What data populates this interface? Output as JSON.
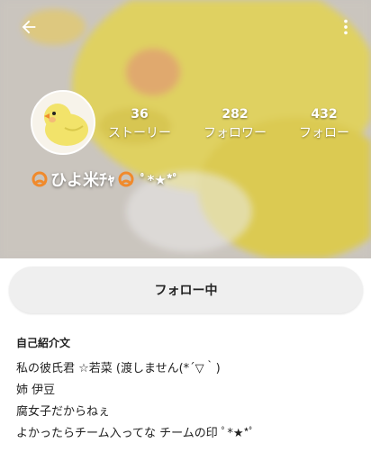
{
  "header": {
    "back_icon": "arrow-left-icon",
    "more_icon": "more-vertical-icon"
  },
  "profile": {
    "avatar_icon": "chick-avatar",
    "name": "ひよ米ﾁｬ",
    "name_suffix": "ﾟ*★*ﾟ",
    "name_decoration_icon": "orange-ornament-icon",
    "stats": [
      {
        "value": "36",
        "label": "ストーリー"
      },
      {
        "value": "282",
        "label": "フォロワー"
      },
      {
        "value": "432",
        "label": "フォロー"
      }
    ]
  },
  "follow_button": {
    "label": "フォロー中"
  },
  "bio": {
    "title": "自己紹介文",
    "lines": [
      "私の彼氏君 ☆若菜 (渡しません(*´▽｀)",
      "姉 伊豆",
      "腐女子だからねぇ",
      "よかったらチーム入ってな チームの印 ﾟ*★*ﾟ"
    ]
  },
  "colors": {
    "chick_yellow": "#f2e36a",
    "ornament_orange": "#f08a2c",
    "button_bg": "#efefef"
  }
}
